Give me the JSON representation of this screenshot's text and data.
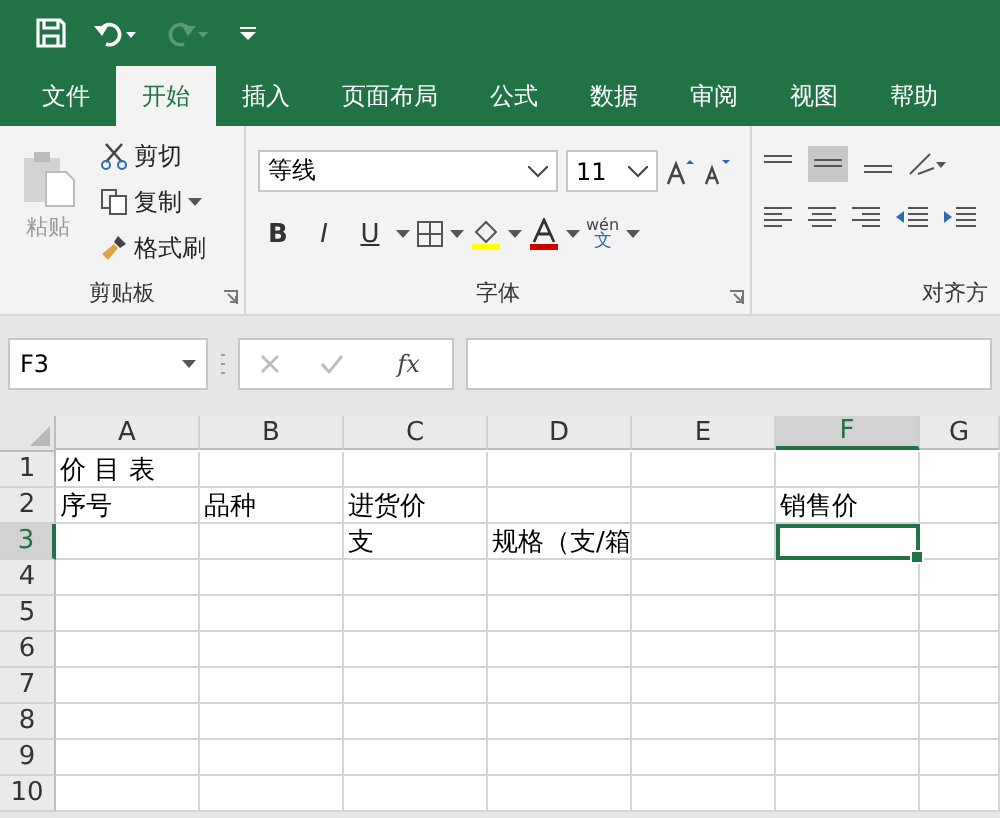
{
  "tabs": [
    {
      "label": "文件",
      "selected": false
    },
    {
      "label": "开始",
      "selected": true
    },
    {
      "label": "插入",
      "selected": false
    },
    {
      "label": "页面布局",
      "selected": false
    },
    {
      "label": "公式",
      "selected": false
    },
    {
      "label": "数据",
      "selected": false
    },
    {
      "label": "审阅",
      "selected": false
    },
    {
      "label": "视图",
      "selected": false
    },
    {
      "label": "帮助",
      "selected": false
    }
  ],
  "clipboard": {
    "paste": "粘贴",
    "cut": "剪切",
    "copy": "复制",
    "format_painter": "格式刷",
    "label": "剪贴板"
  },
  "font": {
    "name": "等线",
    "size": "11",
    "bold": "B",
    "italic": "I",
    "underline": "U",
    "phonetic_top": "wén",
    "phonetic_bottom": "文",
    "label": "字体"
  },
  "alignment": {
    "label": "对齐方"
  },
  "formula_bar": {
    "name_box": "F3",
    "fx": "fx"
  },
  "sheet": {
    "columns": [
      {
        "label": "A",
        "selected": false
      },
      {
        "label": "B",
        "selected": false
      },
      {
        "label": "C",
        "selected": false
      },
      {
        "label": "D",
        "selected": false
      },
      {
        "label": "E",
        "selected": false
      },
      {
        "label": "F",
        "selected": true
      },
      {
        "label": "G",
        "selected": false
      }
    ],
    "rows": [
      {
        "label": "1",
        "selected": false,
        "cells": [
          {
            "text": "价 目 表",
            "selected": false
          },
          {
            "text": "",
            "selected": false
          },
          {
            "text": "",
            "selected": false
          },
          {
            "text": "",
            "selected": false
          },
          {
            "text": "",
            "selected": false
          },
          {
            "text": "",
            "selected": false
          },
          {
            "text": "",
            "selected": false
          }
        ]
      },
      {
        "label": "2",
        "selected": false,
        "cells": [
          {
            "text": "序号",
            "selected": false
          },
          {
            "text": "品种",
            "selected": false
          },
          {
            "text": "进货价",
            "selected": false
          },
          {
            "text": "",
            "selected": false
          },
          {
            "text": "",
            "selected": false
          },
          {
            "text": "销售价",
            "selected": false
          },
          {
            "text": "",
            "selected": false
          }
        ]
      },
      {
        "label": "3",
        "selected": true,
        "cells": [
          {
            "text": "",
            "selected": false
          },
          {
            "text": "",
            "selected": false
          },
          {
            "text": "支",
            "selected": false
          },
          {
            "text": "规格（支/箱",
            "selected": false
          },
          {
            "text": "",
            "selected": false
          },
          {
            "text": "",
            "selected": true
          },
          {
            "text": "",
            "selected": false
          }
        ]
      },
      {
        "label": "4",
        "selected": false,
        "cells": [
          {
            "text": "",
            "selected": false
          },
          {
            "text": "",
            "selected": false
          },
          {
            "text": "",
            "selected": false
          },
          {
            "text": "",
            "selected": false
          },
          {
            "text": "",
            "selected": false
          },
          {
            "text": "",
            "selected": false
          },
          {
            "text": "",
            "selected": false
          }
        ]
      },
      {
        "label": "5",
        "selected": false,
        "cells": [
          {
            "text": "",
            "selected": false
          },
          {
            "text": "",
            "selected": false
          },
          {
            "text": "",
            "selected": false
          },
          {
            "text": "",
            "selected": false
          },
          {
            "text": "",
            "selected": false
          },
          {
            "text": "",
            "selected": false
          },
          {
            "text": "",
            "selected": false
          }
        ]
      },
      {
        "label": "6",
        "selected": false,
        "cells": [
          {
            "text": "",
            "selected": false
          },
          {
            "text": "",
            "selected": false
          },
          {
            "text": "",
            "selected": false
          },
          {
            "text": "",
            "selected": false
          },
          {
            "text": "",
            "selected": false
          },
          {
            "text": "",
            "selected": false
          },
          {
            "text": "",
            "selected": false
          }
        ]
      },
      {
        "label": "7",
        "selected": false,
        "cells": [
          {
            "text": "",
            "selected": false
          },
          {
            "text": "",
            "selected": false
          },
          {
            "text": "",
            "selected": false
          },
          {
            "text": "",
            "selected": false
          },
          {
            "text": "",
            "selected": false
          },
          {
            "text": "",
            "selected": false
          },
          {
            "text": "",
            "selected": false
          }
        ]
      },
      {
        "label": "8",
        "selected": false,
        "cells": [
          {
            "text": "",
            "selected": false
          },
          {
            "text": "",
            "selected": false
          },
          {
            "text": "",
            "selected": false
          },
          {
            "text": "",
            "selected": false
          },
          {
            "text": "",
            "selected": false
          },
          {
            "text": "",
            "selected": false
          },
          {
            "text": "",
            "selected": false
          }
        ]
      },
      {
        "label": "9",
        "selected": false,
        "cells": [
          {
            "text": "",
            "selected": false
          },
          {
            "text": "",
            "selected": false
          },
          {
            "text": "",
            "selected": false
          },
          {
            "text": "",
            "selected": false
          },
          {
            "text": "",
            "selected": false
          },
          {
            "text": "",
            "selected": false
          },
          {
            "text": "",
            "selected": false
          }
        ]
      },
      {
        "label": "10",
        "selected": false,
        "cells": [
          {
            "text": "",
            "selected": false
          },
          {
            "text": "",
            "selected": false
          },
          {
            "text": "",
            "selected": false
          },
          {
            "text": "",
            "selected": false
          },
          {
            "text": "",
            "selected": false
          },
          {
            "text": "",
            "selected": false
          },
          {
            "text": "",
            "selected": false
          }
        ]
      }
    ]
  }
}
